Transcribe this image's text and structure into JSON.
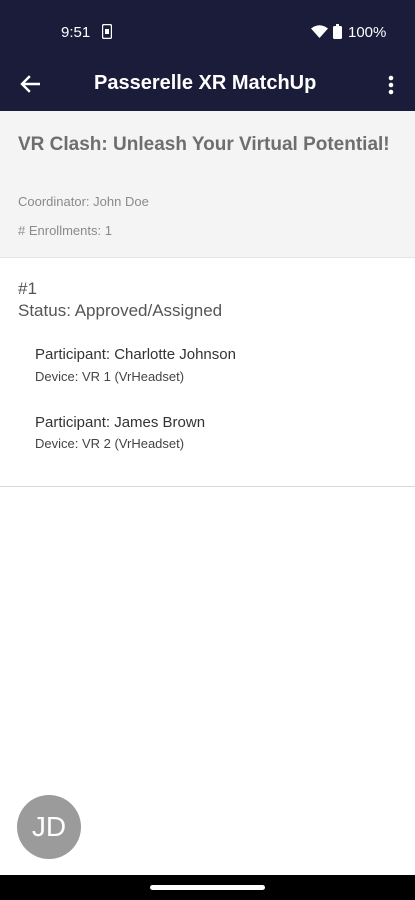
{
  "status_bar": {
    "time": "9:51",
    "battery": "100%",
    "icons": [
      "sim-icon",
      "wifi-icon",
      "battery-icon"
    ]
  },
  "app_bar": {
    "title": "Passerelle XR MatchUp",
    "back_icon": "back-arrow-icon",
    "menu_icon": "overflow-menu-icon"
  },
  "event": {
    "title": "VR Clash: Unleash Your Virtual Potential!",
    "coordinator": "Coordinator: John Doe",
    "enrollments": "# Enrollments: 1"
  },
  "enrollment": {
    "number": "#1",
    "status": "Status: Approved/Assigned",
    "participants": [
      {
        "name": "Participant: Charlotte Johnson",
        "device": "Device: VR 1 (VrHeadset)"
      },
      {
        "name": "Participant: James Brown",
        "device": "Device: VR 2 (VrHeadset)"
      }
    ]
  },
  "user": {
    "initials": "JD"
  },
  "colors": {
    "bar": "#1b1c3a",
    "header_bg": "#f4f4f4",
    "avatar": "#9b9b9b"
  }
}
